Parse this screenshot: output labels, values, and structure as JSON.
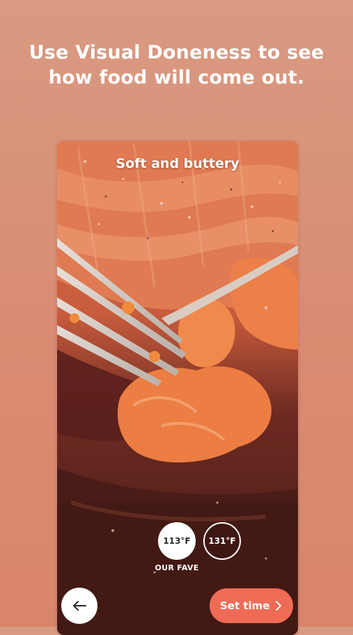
{
  "headline": "Use Visual Doneness to see how food will come out.",
  "card": {
    "caption": "Soft and buttery",
    "temperatures": [
      {
        "label": "113°F",
        "selected": true
      },
      {
        "label": "131°F",
        "selected": false
      }
    ],
    "fave_label": "OUR FAVE"
  },
  "footer": {
    "back_icon": "arrow-left-icon",
    "set_time_label": "Set time",
    "set_time_icon": "chevron-right-icon"
  },
  "colors": {
    "background": "#d98b72",
    "accent": "#ef6b55"
  }
}
